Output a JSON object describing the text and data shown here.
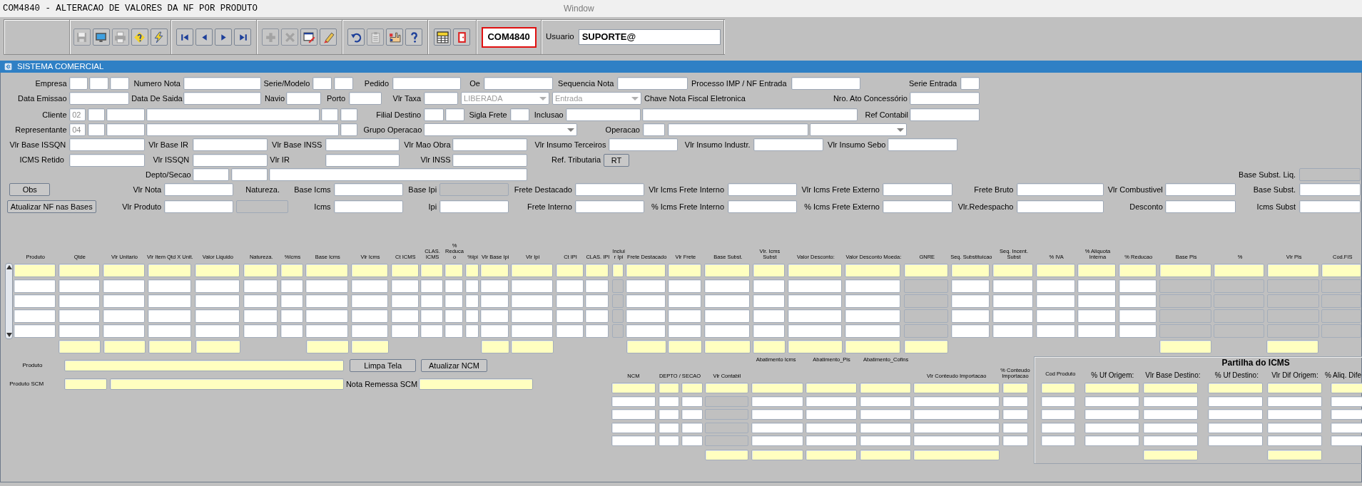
{
  "window": {
    "title": "COM4840 - ALTERACAO DE VALORES DA NF POR PRODUTO",
    "menu": "Window"
  },
  "toolbar": {
    "buttons": [
      {
        "kind": "save",
        "disabled": true
      },
      {
        "kind": "display",
        "disabled": false
      },
      {
        "kind": "print",
        "disabled": true
      },
      {
        "kind": "enter_query",
        "disabled": false
      },
      {
        "kind": "execute_query",
        "disabled": false
      },
      {
        "kind": "first",
        "disabled": false
      },
      {
        "kind": "previous",
        "disabled": false
      },
      {
        "kind": "next",
        "disabled": false
      },
      {
        "kind": "last",
        "disabled": false
      },
      {
        "kind": "insert",
        "disabled": true
      },
      {
        "kind": "delete",
        "disabled": true
      },
      {
        "kind": "edit",
        "disabled": false
      },
      {
        "kind": "clear",
        "disabled": false
      },
      {
        "kind": "undo",
        "disabled": false
      },
      {
        "kind": "copy",
        "disabled": true
      },
      {
        "kind": "help_hand",
        "disabled": false
      },
      {
        "kind": "help",
        "disabled": false
      },
      {
        "kind": "menu",
        "disabled": false
      },
      {
        "kind": "exit",
        "disabled": false
      }
    ],
    "program_code": "COM4840",
    "user_label": "Usuario",
    "user_value": "SUPORTE@"
  },
  "section_title": "SISTEMA COMERCIAL",
  "form_rows": [
    {
      "items": [
        {
          "kind": "label",
          "text": "Empresa"
        },
        {
          "kind": "field",
          "disabled": false
        },
        {
          "kind": "field",
          "disabled": false
        },
        {
          "kind": "field",
          "disabled": false
        },
        {
          "kind": "label",
          "text": "Numero Nota"
        },
        {
          "kind": "field",
          "disabled": false
        },
        {
          "kind": "label",
          "text": "Serie/Modelo"
        },
        {
          "kind": "field",
          "disabled": false
        },
        {
          "kind": "field",
          "disabled": false
        },
        {
          "kind": "label",
          "text": "Pedido"
        },
        {
          "kind": "field",
          "disabled": false
        },
        {
          "kind": "label",
          "text": "Oe"
        },
        {
          "kind": "field",
          "disabled": false
        },
        {
          "kind": "label",
          "text": "Sequencia Nota"
        },
        {
          "kind": "field",
          "disabled": false
        },
        {
          "kind": "label",
          "text": "Processo IMP / NF Entrada"
        },
        {
          "kind": "field",
          "disabled": false
        },
        {
          "kind": "label",
          "text": "Serie Entrada"
        },
        {
          "kind": "field",
          "disabled": false
        }
      ]
    },
    {
      "items": [
        {
          "kind": "label",
          "text": "Data Emissao"
        },
        {
          "kind": "field",
          "disabled": false
        },
        {
          "kind": "label",
          "text": "Data De Saida"
        },
        {
          "kind": "field",
          "disabled": false
        },
        {
          "kind": "label",
          "text": "Navio"
        },
        {
          "kind": "field",
          "disabled": false
        },
        {
          "kind": "label",
          "text": "Porto"
        },
        {
          "kind": "field",
          "disabled": false
        },
        {
          "kind": "label",
          "text": "Vlr Taxa"
        },
        {
          "kind": "field",
          "disabled": false
        },
        {
          "kind": "dropdown",
          "value": "LIBERADA",
          "disabled": true
        },
        {
          "kind": "dropdown",
          "value": "Entrada",
          "disabled": true
        },
        {
          "kind": "label",
          "text": "Chave Nota Fiscal Eletronica"
        },
        {
          "kind": "label",
          "text": "Nro. Ato Concessório"
        },
        {
          "kind": "field",
          "disabled": false
        }
      ]
    },
    {
      "items": [
        {
          "kind": "label",
          "text": "Cliente"
        },
        {
          "kind": "field",
          "value": "02",
          "disabled": false
        },
        {
          "kind": "field",
          "disabled": false
        },
        {
          "kind": "field",
          "disabled": false
        },
        {
          "kind": "field",
          "disabled": false
        },
        {
          "kind": "field",
          "disabled": false
        },
        {
          "kind": "field",
          "disabled": false
        },
        {
          "kind": "label",
          "text": "Filial Destino"
        },
        {
          "kind": "field",
          "disabled": false
        },
        {
          "kind": "field",
          "disabled": false
        },
        {
          "kind": "label",
          "text": "Sigla Frete"
        },
        {
          "kind": "field",
          "disabled": false
        },
        {
          "kind": "label",
          "text": "Inclusao"
        },
        {
          "kind": "field",
          "disabled": false
        },
        {
          "kind": "field",
          "disabled": false
        },
        {
          "kind": "label",
          "text": "Ref Contabil"
        },
        {
          "kind": "field",
          "disabled": false
        }
      ]
    },
    {
      "items": [
        {
          "kind": "label",
          "text": "Representante"
        },
        {
          "kind": "field",
          "value": "04",
          "disabled": false
        },
        {
          "kind": "field",
          "disabled": false
        },
        {
          "kind": "field",
          "disabled": false
        },
        {
          "kind": "field",
          "disabled": false
        },
        {
          "kind": "field",
          "disabled": false
        },
        {
          "kind": "label",
          "text": "Grupo Operacao"
        },
        {
          "kind": "dropdown",
          "disabled": false
        },
        {
          "kind": "label",
          "text": "Operacao"
        },
        {
          "kind": "field",
          "disabled": false
        },
        {
          "kind": "field",
          "disabled": false
        },
        {
          "kind": "dropdown",
          "disabled": false
        }
      ]
    },
    {
      "items": [
        {
          "kind": "label",
          "text": "Vlr Base ISSQN"
        },
        {
          "kind": "field",
          "disabled": false
        },
        {
          "kind": "label",
          "text": "Vlr Base IR"
        },
        {
          "kind": "field",
          "disabled": false
        },
        {
          "kind": "label",
          "text": "Vlr Base INSS"
        },
        {
          "kind": "field",
          "disabled": false
        },
        {
          "kind": "label",
          "text": "Vlr Mao Obra"
        },
        {
          "kind": "field",
          "disabled": false
        },
        {
          "kind": "label",
          "text": "Vlr Insumo Terceiros"
        },
        {
          "kind": "field",
          "disabled": false
        },
        {
          "kind": "label",
          "text": "Vlr Insumo Industr."
        },
        {
          "kind": "field",
          "disabled": false
        },
        {
          "kind": "label",
          "text": "Vlr Insumo Sebo"
        },
        {
          "kind": "field",
          "disabled": false
        }
      ]
    },
    {
      "items": [
        {
          "kind": "label",
          "text": "ICMS Retido"
        },
        {
          "kind": "field",
          "disabled": false
        },
        {
          "kind": "label",
          "text": "Vlr ISSQN"
        },
        {
          "kind": "field",
          "disabled": false
        },
        {
          "kind": "label",
          "text": "Vlr IR"
        },
        {
          "kind": "field",
          "disabled": false
        },
        {
          "kind": "label",
          "text": "Vlr INSS"
        },
        {
          "kind": "field",
          "disabled": false
        },
        {
          "kind": "label",
          "text": "Ref. Tributaria"
        },
        {
          "kind": "button",
          "text": "RT"
        }
      ]
    },
    {
      "items": [
        {
          "kind": "label",
          "text": "Depto/Secao"
        },
        {
          "kind": "field",
          "disabled": false
        },
        {
          "kind": "field",
          "disabled": false
        },
        {
          "kind": "field",
          "disabled": false
        },
        {
          "kind": "label",
          "text": "Base Subst. Liq."
        },
        {
          "kind": "field",
          "disabled": true
        }
      ]
    },
    {
      "items": [
        {
          "kind": "button",
          "text": "Obs"
        },
        {
          "kind": "label",
          "text": "Vlr Nota"
        },
        {
          "kind": "field",
          "disabled": false
        },
        {
          "kind": "label",
          "text": "Natureza."
        },
        {
          "kind": "label",
          "text": "Base Icms"
        },
        {
          "kind": "field",
          "disabled": false
        },
        {
          "kind": "label",
          "text": "Base Ipi"
        },
        {
          "kind": "field",
          "disabled": true
        },
        {
          "kind": "label",
          "text": "Frete Destacado"
        },
        {
          "kind": "field",
          "disabled": false
        },
        {
          "kind": "label",
          "text": "Vlr Icms Frete Interno"
        },
        {
          "kind": "field",
          "disabled": false
        },
        {
          "kind": "label",
          "text": "Vlr Icms Frete Externo"
        },
        {
          "kind": "field",
          "disabled": false
        },
        {
          "kind": "label",
          "text": "Frete Bruto"
        },
        {
          "kind": "field",
          "disabled": false
        },
        {
          "kind": "label",
          "text": "Vlr Combustivel"
        },
        {
          "kind": "field",
          "disabled": false
        },
        {
          "kind": "label",
          "text": "Base Subst."
        },
        {
          "kind": "field",
          "disabled": false
        }
      ]
    },
    {
      "items": [
        {
          "kind": "button",
          "text": "Atualizar NF nas Bases"
        },
        {
          "kind": "label",
          "text": "Vlr Produto"
        },
        {
          "kind": "field",
          "disabled": false
        },
        {
          "kind": "field",
          "disabled": true
        },
        {
          "kind": "label",
          "text": "Icms"
        },
        {
          "kind": "field",
          "disabled": false
        },
        {
          "kind": "label",
          "text": "Ipi"
        },
        {
          "kind": "field",
          "disabled": false
        },
        {
          "kind": "label",
          "text": "Frete Interno"
        },
        {
          "kind": "field",
          "disabled": false
        },
        {
          "kind": "label",
          "text": "% Icms Frete Interno"
        },
        {
          "kind": "field",
          "disabled": false
        },
        {
          "kind": "label",
          "text": "% Icms Frete Externo"
        },
        {
          "kind": "field",
          "disabled": false
        },
        {
          "kind": "label",
          "text": "Vlr.Redespacho"
        },
        {
          "kind": "field",
          "disabled": false
        },
        {
          "kind": "label",
          "text": "Desconto"
        },
        {
          "kind": "field",
          "disabled": false
        },
        {
          "kind": "label",
          "text": "Icms Subst"
        },
        {
          "kind": "field",
          "disabled": false
        }
      ]
    }
  ],
  "items_table": {
    "columns": [
      {
        "header": "Produto",
        "disabled": false,
        "total": false
      },
      {
        "header": "Qtde",
        "disabled": false,
        "total": true
      },
      {
        "header": "Vlr Unitario",
        "disabled": false,
        "total": true
      },
      {
        "header": "Vlr Item Qtd X Unit.",
        "disabled": false,
        "total": true
      },
      {
        "header": "Valor Liquido",
        "disabled": false,
        "total": true
      },
      {
        "header": "Natureza.",
        "disabled": false,
        "total": false
      },
      {
        "header": "%Icms",
        "disabled": false,
        "total": false
      },
      {
        "header": "Base Icms",
        "disabled": false,
        "total": true
      },
      {
        "header": "Vlr Icms",
        "disabled": false,
        "total": true
      },
      {
        "header": "Ct ICMS",
        "disabled": false,
        "total": false
      },
      {
        "header": "CLAS. ICMS",
        "disabled": false,
        "total": false
      },
      {
        "header": "% Reducao",
        "disabled": false,
        "total": false
      },
      {
        "header": "%Ipi",
        "disabled": false,
        "total": false
      },
      {
        "header": "Vlr Base Ipi",
        "disabled": false,
        "total": true
      },
      {
        "header": "Vlr Ipi",
        "disabled": false,
        "total": true
      },
      {
        "header": "Ct IPI",
        "disabled": false,
        "total": false
      },
      {
        "header": "CLAS. IPI",
        "disabled": false,
        "total": false
      },
      {
        "header": "Incluir Ipi",
        "disabled": true,
        "total": false
      },
      {
        "header": "Frete Destacado",
        "disabled": false,
        "total": true
      },
      {
        "header": "Vlr Frete",
        "disabled": false,
        "total": true
      },
      {
        "header": "Base Subst.",
        "disabled": false,
        "total": true
      },
      {
        "header": "Vlr. Icms Subst",
        "disabled": false,
        "total": true
      },
      {
        "header": "Valor Desconto:",
        "disabled": false,
        "total": true
      },
      {
        "header": "Valor Desconto Moeda:",
        "disabled": false,
        "total": true
      },
      {
        "header": "GNRE",
        "disabled": true,
        "total": true
      },
      {
        "header": "Seq. Substituicao",
        "disabled": false,
        "total": false
      },
      {
        "header": "Seq. Incent. Subst",
        "disabled": false,
        "total": false
      },
      {
        "header": "% IVA",
        "disabled": false,
        "total": false
      },
      {
        "header": "% Aliquota Interna",
        "disabled": false,
        "total": false
      },
      {
        "header": "% Reducao",
        "disabled": false,
        "total": false
      },
      {
        "header": "Base Pis",
        "disabled": true,
        "total": true
      },
      {
        "header": "%",
        "disabled": true,
        "total": false
      },
      {
        "header": "Vlr Pis",
        "disabled": true,
        "total": true
      },
      {
        "header": "Cod.FIS",
        "disabled": true,
        "total": false
      }
    ],
    "rows": [
      {
        "selected": true
      },
      {
        "selected": false
      },
      {
        "selected": false
      },
      {
        "selected": false
      },
      {
        "selected": false
      }
    ]
  },
  "product_rows": [
    {
      "items": [
        {
          "kind": "caption",
          "text": "Produto"
        },
        {
          "kind": "field",
          "disabled": false,
          "current": true
        },
        {
          "kind": "button",
          "text": "Limpa Tela"
        },
        {
          "kind": "button",
          "text": "Atualizar NCM"
        }
      ]
    },
    {
      "items": [
        {
          "kind": "caption",
          "text": "Produto SCM"
        },
        {
          "kind": "field",
          "disabled": false,
          "current": true
        },
        {
          "kind": "field",
          "disabled": false,
          "current": true
        },
        {
          "kind": "label",
          "text": "Nota Remessa SCM"
        },
        {
          "kind": "field",
          "disabled": false,
          "current": true
        }
      ]
    }
  ],
  "ncm_table": {
    "columns": [
      {
        "header": "NCM",
        "disabled": false,
        "total": false
      },
      {
        "header": "DEPTO / SECAO",
        "disabled": false,
        "total": false
      },
      {
        "disabled": false,
        "total": false
      },
      {
        "header": "Vlr Contabil",
        "disabled": true,
        "total": true
      },
      {
        "header": "Abatimento Icms",
        "disabled": false,
        "total": true
      },
      {
        "header": "Abatimento_Pis",
        "disabled": false,
        "total": true
      },
      {
        "header": "Abatimento_Cofins",
        "disabled": false,
        "total": true
      },
      {
        "header": "Vlr Conteudo Importacao",
        "disabled": false,
        "total": true
      },
      {
        "header": "% Conteudo Importacao",
        "disabled": false,
        "total": false
      }
    ],
    "rows": [
      {
        "selected": true
      },
      {
        "selected": false
      },
      {
        "selected": false
      },
      {
        "selected": false
      },
      {
        "selected": false
      }
    ]
  },
  "icms_sharing": {
    "title": "Partilha do ICMS",
    "columns": [
      {
        "header": "Cod Produto",
        "total": false
      },
      {
        "header": "% Uf Origem:",
        "total": false
      },
      {
        "header": "Vlr Base Destino:",
        "total": true
      },
      {
        "header": "% Uf Destino:",
        "total": false
      },
      {
        "header": "Vlr Dif Origem:",
        "total": true
      },
      {
        "header": "% Aliq. Dife",
        "total": false
      }
    ],
    "rows": [
      {
        "selected": true
      },
      {
        "selected": false
      },
      {
        "selected": false
      },
      {
        "selected": false
      },
      {
        "selected": false
      }
    ]
  }
}
